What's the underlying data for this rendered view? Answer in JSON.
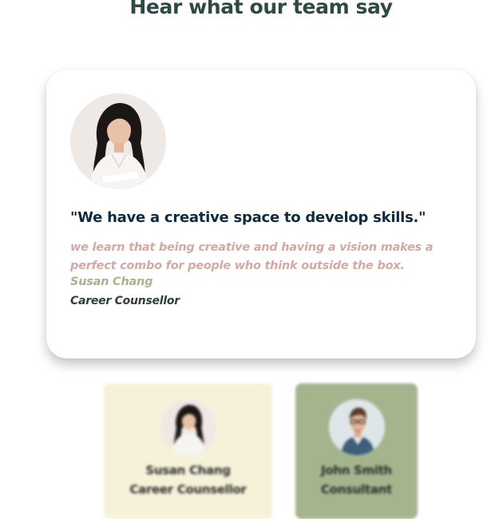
{
  "section": {
    "heading": "Hear what our team say"
  },
  "featured": {
    "quote": "\"We have a creative space to develop skills.\"",
    "description": "we learn that being creative and having a vision makes a perfect combo for people who think outside the box.",
    "name": "Susan Chang",
    "role": "Career Counsellor",
    "avatar_icon": "woman-portrait"
  },
  "team": [
    {
      "name": "Susan Chang",
      "role": "Career Counsellor",
      "avatar_icon": "woman-portrait",
      "bg": "#f6f2d9"
    },
    {
      "name": "John Smith",
      "role": "Consultant",
      "avatar_icon": "man-portrait",
      "bg": "#a4b58e"
    }
  ],
  "colors": {
    "heading": "#2f4a45",
    "quote": "#0f2b3d",
    "description": "#d4a8a4",
    "name": "#a4b58e",
    "role": "#2f3e3a"
  }
}
